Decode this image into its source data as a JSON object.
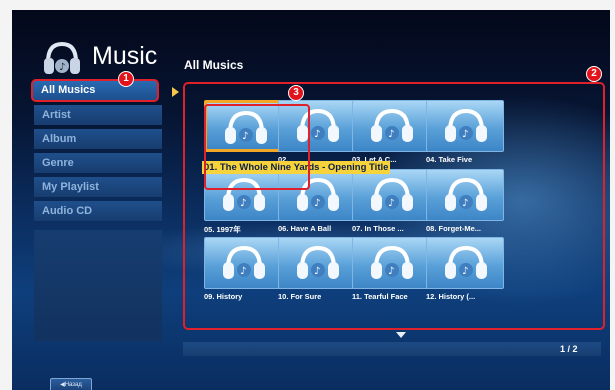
{
  "header": {
    "app_title": "Music",
    "section_title": "All Musics",
    "logo_icon": "headphones-logo-icon"
  },
  "sidebar": {
    "items": [
      {
        "label": "All Musics",
        "active": true
      },
      {
        "label": "Artist",
        "active": false
      },
      {
        "label": "Album",
        "active": false
      },
      {
        "label": "Genre",
        "active": false
      },
      {
        "label": "My Playlist",
        "active": false
      },
      {
        "label": "Audio CD",
        "active": false
      }
    ]
  },
  "grid": {
    "tracks": [
      {
        "label": "01. The Whole Nine Yards - Opening Title"
      },
      {
        "label": "02."
      },
      {
        "label": "03. Let A C..."
      },
      {
        "label": "04. Take Five"
      },
      {
        "label": "05. 1997年"
      },
      {
        "label": "06. Have A Ball"
      },
      {
        "label": "07. In Those ..."
      },
      {
        "label": "08. Forget-Me..."
      },
      {
        "label": "09. History"
      },
      {
        "label": "10. For Sure"
      },
      {
        "label": "11. Tearful Face"
      },
      {
        "label": "12. History (..."
      }
    ],
    "selected_index": 0,
    "thumb_icon": "headphones-icon"
  },
  "pagination": {
    "indicator": "1 / 2",
    "scroll_icon": "down-arrow-icon"
  },
  "footer": {
    "back_label": "◀Назад"
  },
  "markers": {
    "m1": "1",
    "m2": "2",
    "m3": "3"
  },
  "colors": {
    "highlight": "#f6d33a",
    "selection_border": "#f2a826",
    "annotation_red": "#e0202a"
  }
}
